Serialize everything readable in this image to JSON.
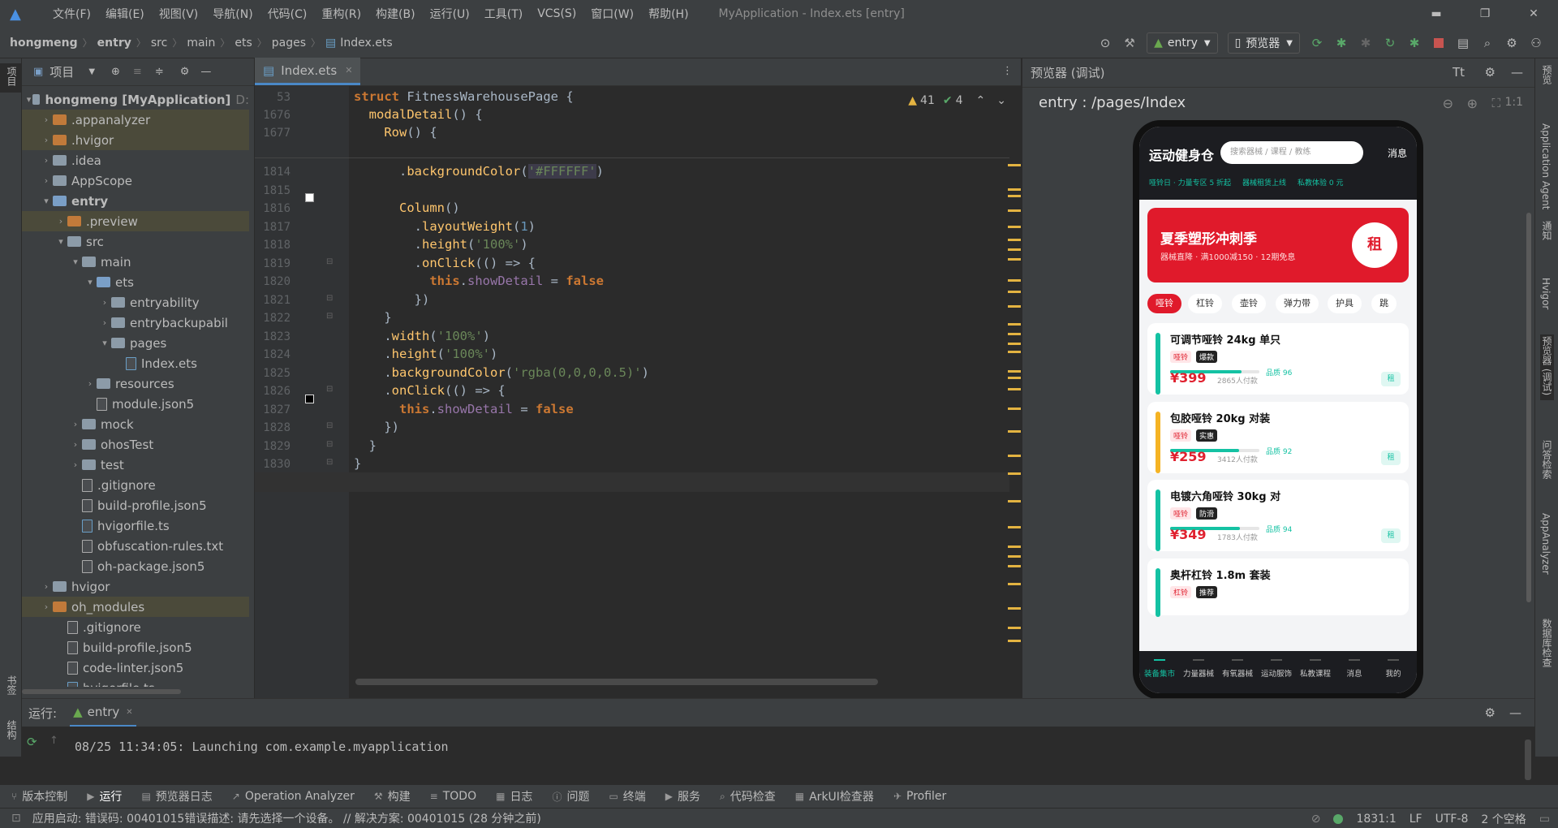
{
  "menubar": {
    "items": [
      "文件(F)",
      "编辑(E)",
      "视图(V)",
      "导航(N)",
      "代码(C)",
      "重构(R)",
      "构建(B)",
      "运行(U)",
      "工具(T)",
      "VCS(S)",
      "窗口(W)",
      "帮助(H)"
    ],
    "title": "MyApplication - Index.ets [entry]"
  },
  "navbar": {
    "crumbs": [
      "hongmeng",
      "entry",
      "src",
      "main",
      "ets",
      "pages",
      "Index.ets"
    ],
    "run_config": "entry",
    "device": "预览器"
  },
  "project": {
    "header": "项目",
    "tree": [
      {
        "label": "hongmeng [MyApplication]",
        "suffix": "D:",
        "depth": 0,
        "kind": "folder-gray",
        "arrow": "▾",
        "hl": false
      },
      {
        "label": ".appanalyzer",
        "depth": 1,
        "kind": "folder-orange",
        "arrow": "›",
        "hl": true
      },
      {
        "label": ".hvigor",
        "depth": 1,
        "kind": "folder-orange",
        "arrow": "›",
        "hl": true
      },
      {
        "label": ".idea",
        "depth": 1,
        "kind": "folder-gray",
        "arrow": "›",
        "hl": false
      },
      {
        "label": "AppScope",
        "depth": 1,
        "kind": "folder-gray",
        "arrow": "›",
        "hl": false
      },
      {
        "label": "entry",
        "depth": 1,
        "kind": "folder-blue",
        "arrow": "▾",
        "hl": false,
        "bold": true
      },
      {
        "label": ".preview",
        "depth": 2,
        "kind": "folder-orange",
        "arrow": "›",
        "hl": true
      },
      {
        "label": "src",
        "depth": 2,
        "kind": "folder-gray",
        "arrow": "▾",
        "hl": false
      },
      {
        "label": "main",
        "depth": 3,
        "kind": "folder-gray",
        "arrow": "▾",
        "hl": false
      },
      {
        "label": "ets",
        "depth": 4,
        "kind": "folder-blue",
        "arrow": "▾",
        "hl": false
      },
      {
        "label": "entryability",
        "depth": 5,
        "kind": "folder-gray",
        "arrow": "›",
        "hl": false
      },
      {
        "label": "entrybackupabil",
        "depth": 5,
        "kind": "folder-gray",
        "arrow": "›",
        "hl": false
      },
      {
        "label": "pages",
        "depth": 5,
        "kind": "folder-gray",
        "arrow": "▾",
        "hl": false
      },
      {
        "label": "Index.ets",
        "depth": 6,
        "kind": "file-ts",
        "arrow": "",
        "hl": false
      },
      {
        "label": "resources",
        "depth": 4,
        "kind": "folder-gray",
        "arrow": "›",
        "hl": false
      },
      {
        "label": "module.json5",
        "depth": 4,
        "kind": "file",
        "arrow": "",
        "hl": false
      },
      {
        "label": "mock",
        "depth": 3,
        "kind": "folder-gray",
        "arrow": "›",
        "hl": false
      },
      {
        "label": "ohosTest",
        "depth": 3,
        "kind": "folder-gray",
        "arrow": "›",
        "hl": false
      },
      {
        "label": "test",
        "depth": 3,
        "kind": "folder-gray",
        "arrow": "›",
        "hl": false
      },
      {
        "label": ".gitignore",
        "depth": 3,
        "kind": "file",
        "arrow": "",
        "hl": false
      },
      {
        "label": "build-profile.json5",
        "depth": 3,
        "kind": "file",
        "arrow": "",
        "hl": false
      },
      {
        "label": "hvigorfile.ts",
        "depth": 3,
        "kind": "file-ts",
        "arrow": "",
        "hl": false
      },
      {
        "label": "obfuscation-rules.txt",
        "depth": 3,
        "kind": "file",
        "arrow": "",
        "hl": false
      },
      {
        "label": "oh-package.json5",
        "depth": 3,
        "kind": "file",
        "arrow": "",
        "hl": false
      },
      {
        "label": "hvigor",
        "depth": 1,
        "kind": "folder-gray",
        "arrow": "›",
        "hl": false
      },
      {
        "label": "oh_modules",
        "depth": 1,
        "kind": "folder-orange",
        "arrow": "›",
        "hl": true
      },
      {
        "label": ".gitignore",
        "depth": 2,
        "kind": "file",
        "arrow": "",
        "hl": false
      },
      {
        "label": "build-profile.json5",
        "depth": 2,
        "kind": "file",
        "arrow": "",
        "hl": false
      },
      {
        "label": "code-linter.json5",
        "depth": 2,
        "kind": "file",
        "arrow": "",
        "hl": false
      },
      {
        "label": "hvigorfile.ts",
        "depth": 2,
        "kind": "file-ts",
        "arrow": "",
        "hl": false
      }
    ]
  },
  "editor": {
    "tab": "Index.ets",
    "warnings": "41",
    "checks": "4",
    "sticky": [
      {
        "ln": "53",
        "html": "<span class='kw'>struct</span> <span class='cls'>FitnessWarehousePage</span> {"
      },
      {
        "ln": "1676",
        "html": "  <span class='fn'>modalDetail</span>() {"
      },
      {
        "ln": "1677",
        "html": "    <span class='fn'>Row</span>() {"
      }
    ],
    "lines": [
      {
        "ln": "1814",
        "html": "      .<span class='fn'>backgroundColor</span>(<span class='str' style='background:#3d3b4a'>'#FFFFFF'</span>)"
      },
      {
        "ln": "1815",
        "html": ""
      },
      {
        "ln": "1816",
        "html": "      <span class='fn'>Column</span>()"
      },
      {
        "ln": "1817",
        "html": "        .<span class='fn'>layoutWeight</span>(<span class='num'>1</span>)"
      },
      {
        "ln": "1818",
        "html": "        .<span class='fn'>height</span>(<span class='str'>'100%'</span>)"
      },
      {
        "ln": "1819",
        "html": "        .<span class='fn'>onClick</span>(() => {"
      },
      {
        "ln": "1820",
        "html": "          <span class='this'>this</span>.<span class='prop'>showDetail</span> = <span class='bool'>false</span>"
      },
      {
        "ln": "1821",
        "html": "        })"
      },
      {
        "ln": "1822",
        "html": "    }"
      },
      {
        "ln": "1823",
        "html": "    .<span class='fn'>width</span>(<span class='str'>'100%'</span>)"
      },
      {
        "ln": "1824",
        "html": "    .<span class='fn'>height</span>(<span class='str'>'100%'</span>)"
      },
      {
        "ln": "1825",
        "html": "    .<span class='fn'>backgroundColor</span>(<span class='str'>'rgba(0,0,0,0.5)'</span>)"
      },
      {
        "ln": "1826",
        "html": "    .<span class='fn'>onClick</span>(() => {"
      },
      {
        "ln": "1827",
        "html": "      <span class='this'>this</span>.<span class='prop'>showDetail</span> = <span class='bool'>false</span>"
      },
      {
        "ln": "1828",
        "html": "    })"
      },
      {
        "ln": "1829",
        "html": "  }"
      },
      {
        "ln": "1830",
        "html": "}"
      },
      {
        "ln": "1831",
        "html": ""
      }
    ]
  },
  "preview": {
    "header": "预览器 (调试)",
    "path": "entry : /pages/Index",
    "app": {
      "title": "运动健身仓",
      "search_placeholder": "搜索器械 / 课程 / 教练",
      "msg": "消息",
      "ticker": [
        "哑铃日 · 力量专区 5 折起",
        "器械租赁上线",
        "私教体验 0 元"
      ],
      "banner_title": "夏季塑形冲刺季",
      "banner_sub": "器械直降 · 满1000减150 · 12期免息",
      "banner_badge": "租",
      "cats": [
        "哑铃",
        "杠铃",
        "壶铃",
        "弹力带",
        "护具",
        "跳"
      ],
      "products": [
        {
          "name": "可调节哑铃 24kg 单只",
          "tag1": "哑铃",
          "tag2": "爆款",
          "rating": "品质 96",
          "price": "¥399",
          "sold": "2865人付款",
          "rent": "租",
          "bar": "#14c2a3",
          "progress": 0.8
        },
        {
          "name": "包胶哑铃 20kg 对装",
          "tag1": "哑铃",
          "tag2": "实惠",
          "rating": "品质 92",
          "price": "¥259",
          "sold": "3412人付款",
          "rent": "租",
          "bar": "#f5b324",
          "progress": 0.77
        },
        {
          "name": "电镀六角哑铃 30kg 对",
          "tag1": "哑铃",
          "tag2": "防滑",
          "rating": "品质 94",
          "price": "¥349",
          "sold": "1783人付款",
          "rent": "租",
          "bar": "#14c2a3",
          "progress": 0.78
        },
        {
          "name": "奥杆杠铃 1.8m 套装",
          "tag1": "杠铃",
          "tag2": "推荐",
          "bar": "#14c2a3"
        }
      ],
      "nav": [
        "装备集市",
        "力量器械",
        "有氧器械",
        "运动服饰",
        "私教课程",
        "消息",
        "我的"
      ]
    }
  },
  "run": {
    "label": "运行:",
    "tab": "entry",
    "log": "08/25 11:34:05: Launching com.example.myapplication"
  },
  "bottom_tools": [
    "版本控制",
    "运行",
    "预览器日志",
    "Operation Analyzer",
    "构建",
    "TODO",
    "日志",
    "问题",
    "终端",
    "服务",
    "代码检查",
    "ArkUI检查器",
    "Profiler"
  ],
  "status": {
    "message": "应用启动: 错误码: 00401015错误描述: 请先选择一个设备。 // 解决方案: 00401015 (28 分钟之前)",
    "position": "1831:1",
    "lf": "LF",
    "encoding": "UTF-8",
    "indent": "2 个空格"
  },
  "left_strip": [
    "项目",
    "书签",
    "结构"
  ],
  "right_strip": [
    "预览",
    "Application Agent",
    "通知",
    "Hvigor",
    "预览器 (调试)",
    "问答检索",
    "AppAnalyzer",
    "数据库检查"
  ]
}
